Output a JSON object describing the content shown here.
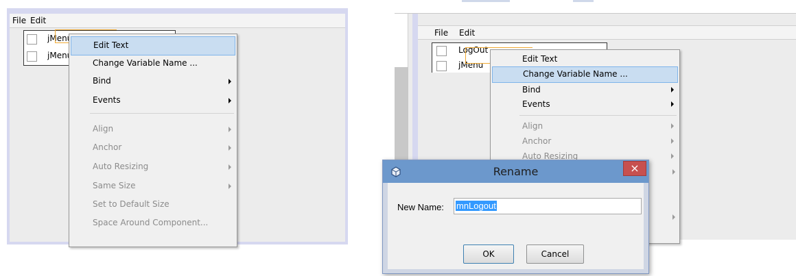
{
  "left": {
    "menubar": {
      "file": "File",
      "edit": "Edit"
    },
    "rows": [
      "jMenu",
      "jMenu"
    ],
    "context_menu": [
      {
        "label": "Edit Text",
        "state": "selected",
        "submenu": false
      },
      {
        "label": "Change Variable Name ...",
        "state": "normal",
        "submenu": false
      },
      {
        "label": "Bind",
        "state": "normal",
        "submenu": true
      },
      {
        "label": "Events",
        "state": "normal",
        "submenu": true
      },
      {
        "label": "Align",
        "state": "disabled",
        "submenu": true
      },
      {
        "label": "Anchor",
        "state": "disabled",
        "submenu": true
      },
      {
        "label": "Auto Resizing",
        "state": "disabled",
        "submenu": true
      },
      {
        "label": "Same Size",
        "state": "disabled",
        "submenu": true
      },
      {
        "label": "Set to Default Size",
        "state": "disabled",
        "submenu": false
      },
      {
        "label": "Space Around Component...",
        "state": "disabled",
        "submenu": false
      }
    ]
  },
  "right": {
    "menubar": {
      "file": "File",
      "edit": "Edit"
    },
    "rows": [
      "LogOut",
      "jMenu"
    ],
    "context_menu": [
      {
        "label": "Edit Text",
        "state": "normal",
        "submenu": false
      },
      {
        "label": "Change Variable Name ...",
        "state": "selected",
        "submenu": false
      },
      {
        "label": "Bind",
        "state": "normal",
        "submenu": true
      },
      {
        "label": "Events",
        "state": "normal",
        "submenu": true
      },
      {
        "label": "Align",
        "state": "disabled",
        "submenu": true
      },
      {
        "label": "Anchor",
        "state": "disabled",
        "submenu": true
      },
      {
        "label": "Auto Resizing",
        "state": "disabled",
        "submenu": true
      }
    ]
  },
  "dialog": {
    "title": "Rename",
    "field_label": "New Name:",
    "field_value": "mnLogout",
    "ok": "OK",
    "cancel": "Cancel",
    "close_glyph": "×"
  },
  "colors": {
    "selection_bg": "#c9ddf1",
    "selection_border": "#7eb4ea",
    "titlebar": "#6c98cc",
    "close_button": "#c7504f",
    "designer_highlight": "#f0a830"
  }
}
